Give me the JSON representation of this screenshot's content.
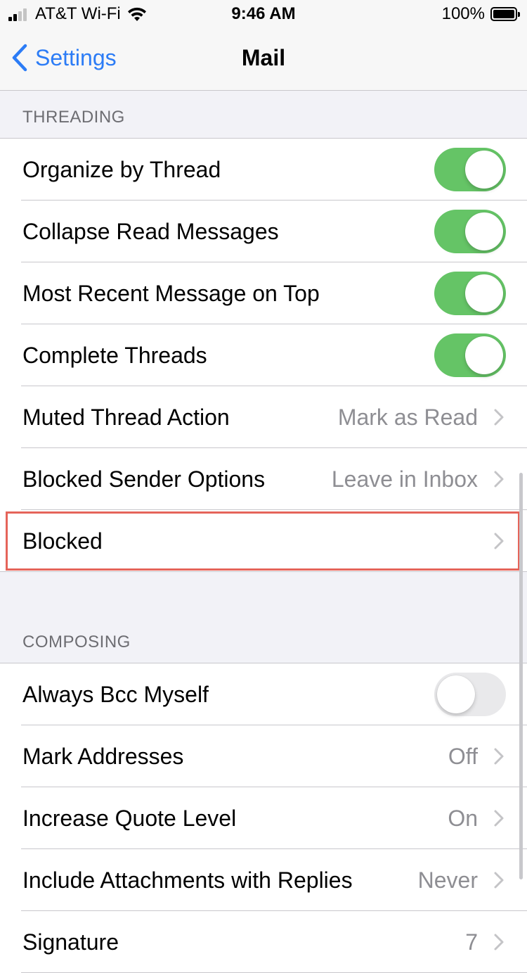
{
  "status_bar": {
    "carrier": "AT&T Wi-Fi",
    "time": "9:46 AM",
    "battery_percent": "100%",
    "signal_icon": "signal-bars-icon",
    "wifi_icon": "wifi-icon",
    "battery_icon": "battery-icon"
  },
  "nav": {
    "back_label": "Settings",
    "back_icon": "chevron-left-icon",
    "title": "Mail"
  },
  "threading": {
    "header": "THREADING",
    "rows": [
      {
        "label": "Organize by Thread",
        "type": "toggle",
        "on": true
      },
      {
        "label": "Collapse Read Messages",
        "type": "toggle",
        "on": true
      },
      {
        "label": "Most Recent Message on Top",
        "type": "toggle",
        "on": true
      },
      {
        "label": "Complete Threads",
        "type": "toggle",
        "on": true
      },
      {
        "label": "Muted Thread Action",
        "type": "disclosure",
        "value": "Mark as Read"
      },
      {
        "label": "Blocked Sender Options",
        "type": "disclosure",
        "value": "Leave in Inbox"
      },
      {
        "label": "Blocked",
        "type": "disclosure",
        "value": ""
      }
    ]
  },
  "composing": {
    "header": "COMPOSING",
    "rows": [
      {
        "label": "Always Bcc Myself",
        "type": "toggle",
        "on": false
      },
      {
        "label": "Mark Addresses",
        "type": "disclosure",
        "value": "Off"
      },
      {
        "label": "Increase Quote Level",
        "type": "disclosure",
        "value": "On"
      },
      {
        "label": "Include Attachments with Replies",
        "type": "disclosure",
        "value": "Never"
      },
      {
        "label": "Signature",
        "type": "disclosure",
        "value": "7"
      }
    ]
  },
  "colors": {
    "accent": "#2c7cf6",
    "toggle_on": "#65c466",
    "toggle_off": "#e9e9eb",
    "highlight": "#e5645a",
    "secondary_text": "#8e8e93",
    "background": "#f2f2f7"
  }
}
